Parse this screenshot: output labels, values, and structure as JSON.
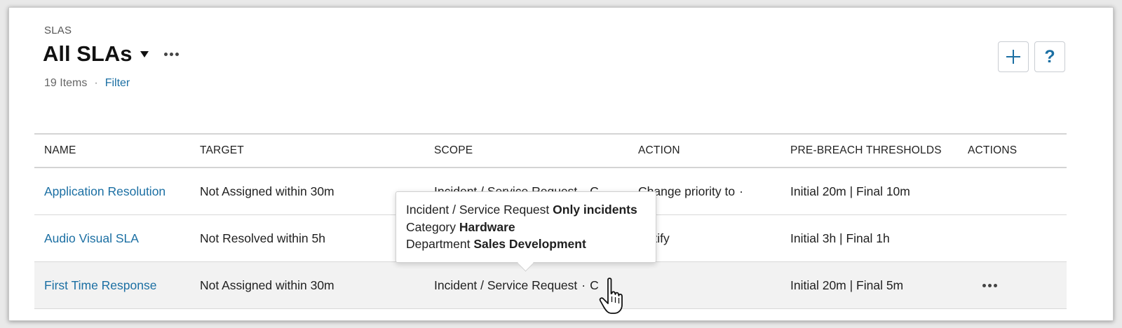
{
  "header": {
    "section_label": "SLAS",
    "title": "All SLAs",
    "item_count": "19 Items",
    "separator": "·",
    "filter_label": "Filter",
    "add_label": "+",
    "help_label": "?"
  },
  "table": {
    "columns": [
      "NAME",
      "TARGET",
      "SCOPE",
      "ACTION",
      "PRE-BREACH THRESHOLDS",
      "ACTIONS"
    ],
    "rows": [
      {
        "name": "Application Resolution",
        "target": "Not Assigned within 30m",
        "scope": "Incident / Service Request",
        "scope_more": "C",
        "action": "Change priority to",
        "action_more": "·",
        "thresholds": "Initial 20m | Final 10m"
      },
      {
        "name": "Audio Visual SLA",
        "target": "Not Resolved within 5h",
        "scope": "",
        "scope_more": "",
        "action": "Notify",
        "action_more": "",
        "thresholds": "Initial 3h | Final 1h"
      },
      {
        "name": "First Time Response",
        "target": "Not Assigned within 30m",
        "scope": "Incident / Service Request",
        "scope_more": "C",
        "action": "",
        "action_more": "",
        "thresholds": "Initial 20m | Final 5m",
        "hovered": true
      }
    ]
  },
  "tooltip": {
    "lines": [
      {
        "label": "Incident / Service Request",
        "value": "Only incidents"
      },
      {
        "label": "Category",
        "value": "Hardware"
      },
      {
        "label": "Department",
        "value": "Sales Development"
      }
    ]
  },
  "colors": {
    "link": "#1b6fa3",
    "hover_row": "#f2f2f2",
    "border": "#d4d4d4"
  }
}
